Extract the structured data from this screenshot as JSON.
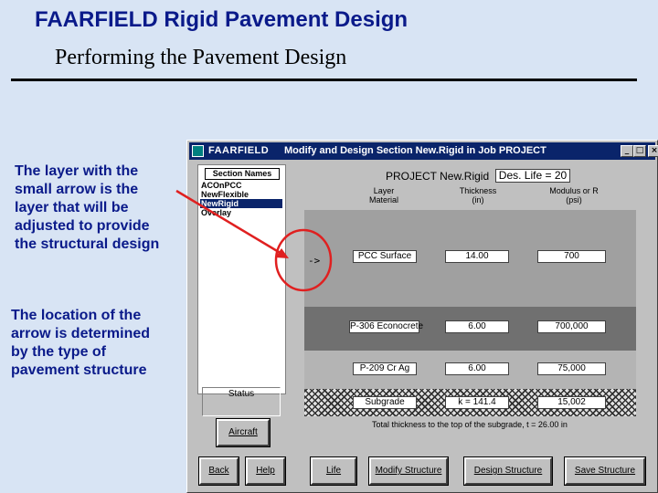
{
  "slide": {
    "title": "FAARFIELD Rigid Pavement Design",
    "subtitle": "Performing the Pavement Design",
    "note1": [
      "The layer with the",
      "small arrow is the",
      "layer that will be",
      "adjusted to provide",
      "the structural design"
    ],
    "note2": [
      "The location of the",
      "arrow is determined",
      "by the type of",
      "pavement structure"
    ]
  },
  "window": {
    "app_name": "FAARFIELD",
    "title": "Modify and Design Section New.Rigid in Job PROJECT",
    "controls": {
      "minimize": "_",
      "maximize": "□",
      "close": "×"
    },
    "sections": {
      "header": "Section Names",
      "items": [
        "ACOnPCC",
        "NewFlexible",
        "NewRigid",
        "Overlay"
      ],
      "selected_index": 2
    },
    "status_label": "Status",
    "aircraft_label": "Aircraft",
    "bottom_buttons": [
      "Back",
      "Help",
      "Life",
      "Modify Structure",
      "Design Structure",
      "Save Structure"
    ]
  },
  "design": {
    "project_line": "PROJECT  New.Rigid",
    "des_life": "Des. Life = 20",
    "columns": {
      "layer": [
        "Layer",
        "Material"
      ],
      "thickness": [
        "Thickness",
        "(in)"
      ],
      "modulus": [
        "Modulus or R",
        "(psi)"
      ]
    },
    "arrow": "->",
    "layers": [
      {
        "material": "PCC Surface",
        "thickness": "14.00",
        "modulus": "700"
      },
      {
        "material": "P-306 Econocrete",
        "thickness": "6.00",
        "modulus": "700,000"
      },
      {
        "material": "P-209 Cr Ag",
        "thickness": "6.00",
        "modulus": "75,000"
      },
      {
        "material": "Subgrade",
        "thickness": "k = 141.4",
        "modulus": "15,002"
      }
    ],
    "total_line": "Total thickness to the top of the subgrade, t = 26.00 in"
  },
  "colors": {
    "title_blue": "#0a1a8a",
    "window_title_bar": "#0a246a",
    "annotation_red": "#e02020"
  }
}
